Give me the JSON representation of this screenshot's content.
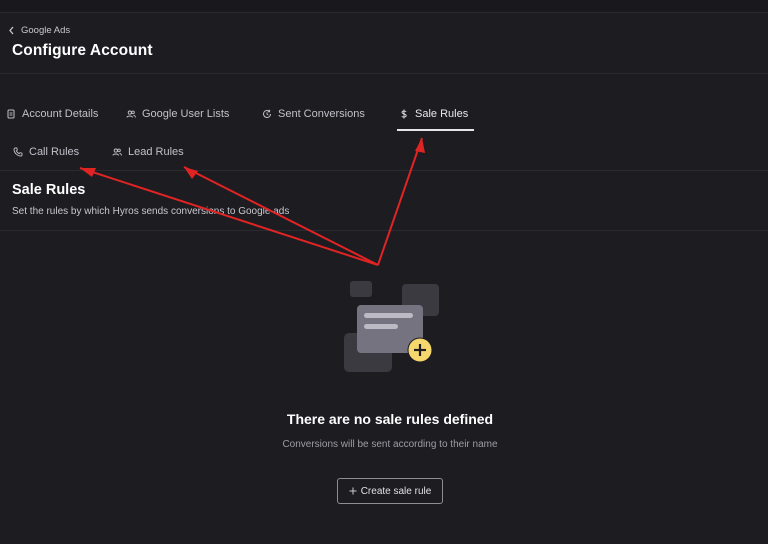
{
  "header": {
    "back_label": "Google Ads",
    "title": "Configure Account"
  },
  "tabs": [
    {
      "label": "Account Details",
      "icon": "document-icon"
    },
    {
      "label": "Google User Lists",
      "icon": "users-icon"
    },
    {
      "label": "Sent Conversions",
      "icon": "refresh-icon"
    },
    {
      "label": "Sale Rules",
      "icon": "dollar-icon",
      "active": true
    },
    {
      "label": "Call Rules",
      "icon": "phone-icon"
    },
    {
      "label": "Lead Rules",
      "icon": "users-icon"
    }
  ],
  "section": {
    "title": "Sale Rules",
    "subtitle": "Set the rules by which Hyros sends conversions to Google ads"
  },
  "empty_state": {
    "title": "There are no sale rules defined",
    "subtitle": "Conversions will be sent according to their name",
    "button_label": "Create sale rule",
    "button_icon": "plus-icon"
  },
  "colors": {
    "background": "#1d1c21",
    "annotation_arrow": "#e02424",
    "plus_badge": "#f5d76e"
  }
}
